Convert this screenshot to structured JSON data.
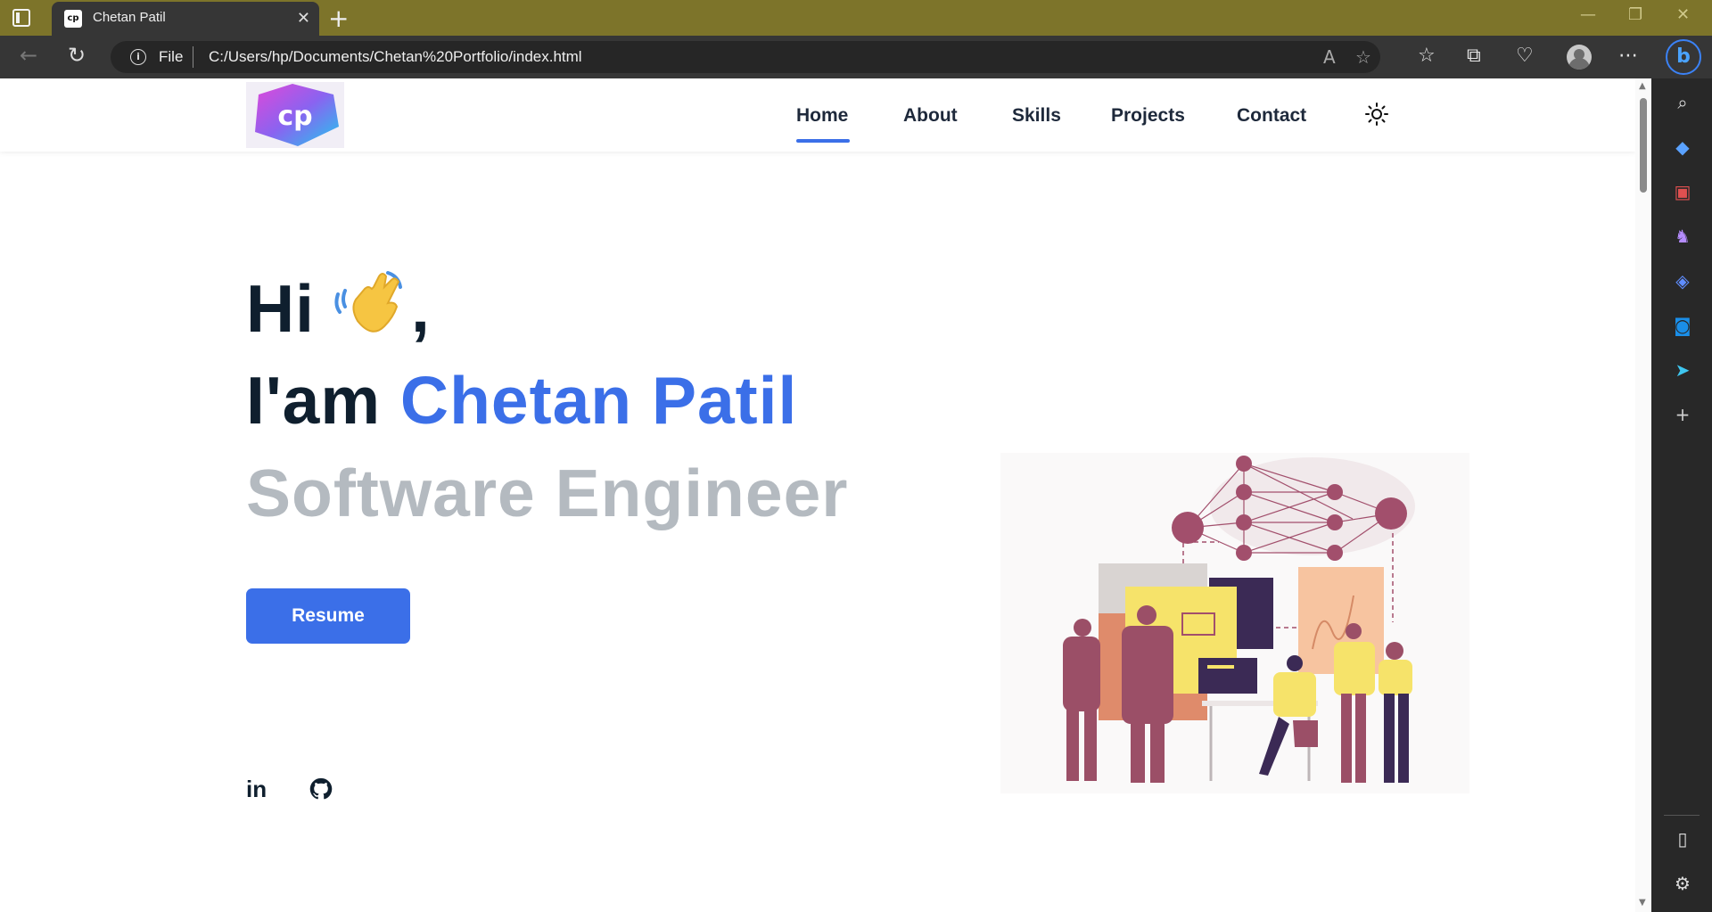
{
  "browser": {
    "tab": {
      "favicon_text": "cp",
      "title": "Chetan Patil"
    },
    "address": {
      "scheme": "File",
      "url": "C:/Users/hp/Documents/Chetan%20Portfolio/index.html"
    },
    "icons": [
      "tab-actions-icon",
      "back-icon",
      "refresh-icon",
      "read-aloud-icon",
      "add-favorite-icon",
      "favorites-icon",
      "collections-icon",
      "browser-essentials-icon",
      "profile-icon",
      "more-icon",
      "bing-copilot-icon"
    ],
    "window_controls": [
      "minimize-icon",
      "restore-icon",
      "close-icon"
    ],
    "sidebar_icons": [
      "search-icon",
      "shopping-tag-icon",
      "tools-icon",
      "games-icon",
      "microsoft-365-icon",
      "outlook-icon",
      "telegram-icon",
      "add-icon",
      "split-screen-icon",
      "settings-icon"
    ],
    "colors": {
      "titlebar": "#7d742a",
      "chrome": "#363636",
      "accent": "#3b6fe8"
    }
  },
  "site": {
    "logo_text": "cp",
    "nav": [
      "Home",
      "About",
      "Skills",
      "Projects",
      "Contact"
    ],
    "active_nav": "Home",
    "hero": {
      "greeting": "Hi",
      "greeting_suffix": ",",
      "intro": "I'am",
      "name": "Chetan Patil",
      "role": "Software Engineer"
    },
    "resume_button": "Resume",
    "social": [
      "linkedin-icon",
      "github-icon"
    ],
    "linkedin_text": "in"
  }
}
